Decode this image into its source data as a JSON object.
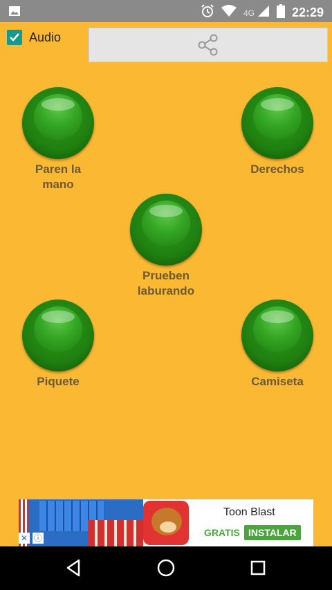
{
  "status_bar": {
    "network": "4G",
    "time": "22:29"
  },
  "header": {
    "audio_label": "Audio",
    "audio_checked": true
  },
  "sounds": [
    {
      "label": "Paren la\nmano"
    },
    {
      "label": "Derechos"
    },
    {
      "label": "Prueben\nlaburando"
    },
    {
      "label": "Piquete"
    },
    {
      "label": "Camiseta"
    }
  ],
  "ad": {
    "title": "Toon Blast",
    "free_label": "GRATIS",
    "install_label": "INSTALAR"
  },
  "colors": {
    "background": "#fbb833",
    "button_green": "#1f7f0f",
    "label_brown": "#6b5a34",
    "checkbox_teal": "#149b8f",
    "ad_green": "#4aa63c"
  }
}
